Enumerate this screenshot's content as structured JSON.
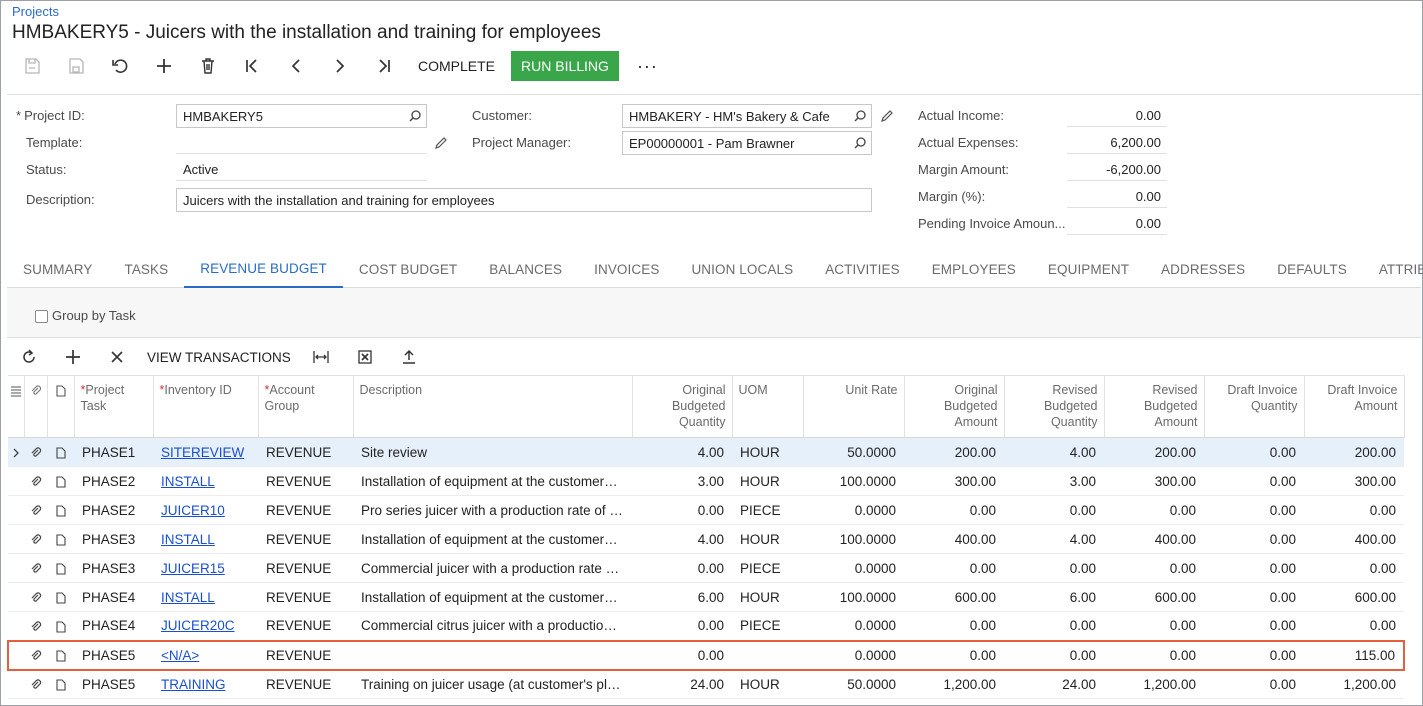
{
  "breadcrumb": "Projects",
  "title": "HMBAKERY5 - Juicers with the installation and training for employees",
  "toolbar": {
    "complete_label": "COMPLETE",
    "run_billing_label": "RUN BILLING",
    "more_label": "···"
  },
  "form": {
    "project_id_label": "Project ID:",
    "project_id_value": "HMBAKERY5",
    "template_label": "Template:",
    "template_value": "",
    "status_label": "Status:",
    "status_value": "Active",
    "description_label": "Description:",
    "description_value": "Juicers with the installation and training for employees",
    "customer_label": "Customer:",
    "customer_value": "HMBAKERY - HM's Bakery & Cafe",
    "pm_label": "Project Manager:",
    "pm_value": "EP00000001 - Pam Brawner",
    "actual_income_label": "Actual Income:",
    "actual_income_value": "0.00",
    "actual_expenses_label": "Actual Expenses:",
    "actual_expenses_value": "6,200.00",
    "margin_amount_label": "Margin Amount:",
    "margin_amount_value": "-6,200.00",
    "margin_pct_label": "Margin (%):",
    "margin_pct_value": "0.00",
    "pending_invoice_label": "Pending Invoice Amoun...",
    "pending_invoice_value": "0.00"
  },
  "tabs": [
    "SUMMARY",
    "TASKS",
    "REVENUE BUDGET",
    "COST BUDGET",
    "BALANCES",
    "INVOICES",
    "UNION LOCALS",
    "ACTIVITIES",
    "EMPLOYEES",
    "EQUIPMENT",
    "ADDRESSES",
    "DEFAULTS",
    "ATTRIBUTES"
  ],
  "active_tab": "REVENUE BUDGET",
  "group_by_task_label": "Group by Task",
  "grid_toolbar": {
    "view_transactions_label": "VIEW TRANSACTIONS"
  },
  "columns": {
    "project_task": "Project Task",
    "inventory_id": "Inventory ID",
    "account_group": "Account Group",
    "description": "Description",
    "orig_budget_qty": "Original Budgeted Quantity",
    "uom": "UOM",
    "unit_rate": "Unit Rate",
    "orig_budget_amt": "Original Budgeted Amount",
    "rev_budget_qty": "Revised Budgeted Quantity",
    "rev_budget_amt": "Revised Budgeted Amount",
    "draft_inv_qty": "Draft Invoice Quantity",
    "draft_inv_amt": "Draft Invoice Amount"
  },
  "rows": [
    {
      "task": "PHASE1",
      "inv": "SITEREVIEW",
      "acct": "REVENUE",
      "desc": "Site review",
      "oqty": "4.00",
      "uom": "HOUR",
      "rate": "50.0000",
      "oamt": "200.00",
      "rqty": "4.00",
      "ramt": "200.00",
      "dqty": "0.00",
      "damt": "200.00"
    },
    {
      "task": "PHASE2",
      "inv": "INSTALL",
      "acct": "REVENUE",
      "desc": "Installation of equipment at the customers' ...",
      "oqty": "3.00",
      "uom": "HOUR",
      "rate": "100.0000",
      "oamt": "300.00",
      "rqty": "3.00",
      "ramt": "300.00",
      "dqty": "0.00",
      "damt": "300.00"
    },
    {
      "task": "PHASE2",
      "inv": "JUICER10",
      "acct": "REVENUE",
      "desc": "Pro series juicer with a production rate of 1...",
      "oqty": "0.00",
      "uom": "PIECE",
      "rate": "0.0000",
      "oamt": "0.00",
      "rqty": "0.00",
      "ramt": "0.00",
      "dqty": "0.00",
      "damt": "0.00"
    },
    {
      "task": "PHASE3",
      "inv": "INSTALL",
      "acct": "REVENUE",
      "desc": "Installation of equipment at the customers' ...",
      "oqty": "4.00",
      "uom": "HOUR",
      "rate": "100.0000",
      "oamt": "400.00",
      "rqty": "4.00",
      "ramt": "400.00",
      "dqty": "0.00",
      "damt": "400.00"
    },
    {
      "task": "PHASE3",
      "inv": "JUICER15",
      "acct": "REVENUE",
      "desc": "Commercial juicer with a production rate of ...",
      "oqty": "0.00",
      "uom": "PIECE",
      "rate": "0.0000",
      "oamt": "0.00",
      "rqty": "0.00",
      "ramt": "0.00",
      "dqty": "0.00",
      "damt": "0.00"
    },
    {
      "task": "PHASE4",
      "inv": "INSTALL",
      "acct": "REVENUE",
      "desc": "Installation of equipment at the customers' ...",
      "oqty": "6.00",
      "uom": "HOUR",
      "rate": "100.0000",
      "oamt": "600.00",
      "rqty": "6.00",
      "ramt": "600.00",
      "dqty": "0.00",
      "damt": "600.00"
    },
    {
      "task": "PHASE4",
      "inv": "JUICER20C",
      "acct": "REVENUE",
      "desc": "Commercial citrus juicer with a production r...",
      "oqty": "0.00",
      "uom": "PIECE",
      "rate": "0.0000",
      "oamt": "0.00",
      "rqty": "0.00",
      "ramt": "0.00",
      "dqty": "0.00",
      "damt": "0.00"
    },
    {
      "task": "PHASE5",
      "inv": "<N/A>",
      "acct": "REVENUE",
      "desc": "",
      "oqty": "0.00",
      "uom": "",
      "rate": "0.0000",
      "oamt": "0.00",
      "rqty": "0.00",
      "ramt": "0.00",
      "dqty": "0.00",
      "damt": "115.00"
    },
    {
      "task": "PHASE5",
      "inv": "TRAINING",
      "acct": "REVENUE",
      "desc": "Training on juicer usage (at customer's place)",
      "oqty": "24.00",
      "uom": "HOUR",
      "rate": "50.0000",
      "oamt": "1,200.00",
      "rqty": "24.00",
      "ramt": "1,200.00",
      "dqty": "0.00",
      "damt": "1,200.00"
    }
  ],
  "colors": {
    "accent": "#2a6cc4",
    "run_billing": "#3aa64a",
    "highlight": "#e3603c",
    "selected_row": "#e6f0fa"
  }
}
